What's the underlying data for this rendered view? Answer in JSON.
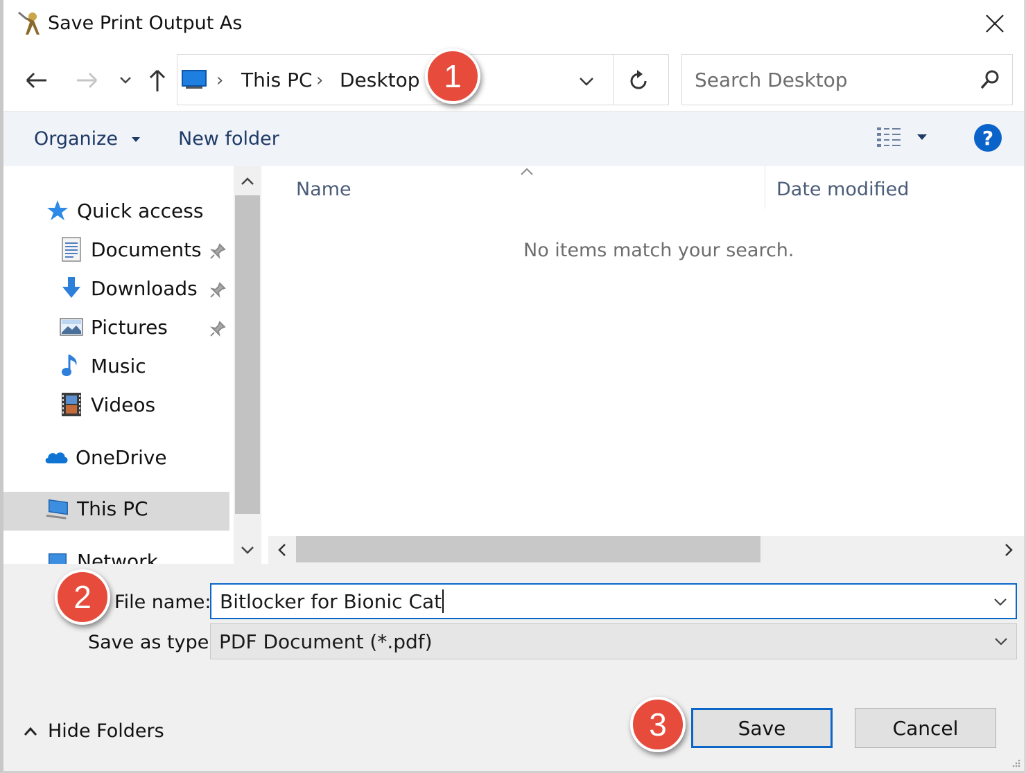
{
  "window": {
    "title": "Save Print Output As"
  },
  "address": {
    "crumbs": [
      "This PC",
      "Desktop"
    ]
  },
  "search": {
    "placeholder": "Search Desktop"
  },
  "toolbar": {
    "organize": "Organize",
    "new_folder": "New folder"
  },
  "nav": {
    "quick_access": "Quick access",
    "items": [
      {
        "label": "Documents",
        "icon": "documents-icon",
        "pinned": true
      },
      {
        "label": "Downloads",
        "icon": "downloads-icon",
        "pinned": true
      },
      {
        "label": "Pictures",
        "icon": "pictures-icon",
        "pinned": true
      },
      {
        "label": "Music",
        "icon": "music-icon",
        "pinned": false
      },
      {
        "label": "Videos",
        "icon": "videos-icon",
        "pinned": false
      }
    ],
    "onedrive": "OneDrive",
    "this_pc": "This PC",
    "network": "Network"
  },
  "filelist": {
    "columns": [
      "Name",
      "Date modified"
    ],
    "empty_message": "No items match your search."
  },
  "form": {
    "file_name_label": "File name:",
    "file_name_value": "Bitlocker for Bionic Cat",
    "save_type_label": "Save as type:",
    "save_type_value": "PDF Document (*.pdf)"
  },
  "footer": {
    "hide_folders": "Hide Folders",
    "save": "Save",
    "cancel": "Cancel"
  },
  "callouts": [
    "1",
    "2",
    "3"
  ],
  "colors": {
    "accent": "#0b66c8",
    "callout": "#e64b3c",
    "toolbar_text": "#1e3a66"
  }
}
